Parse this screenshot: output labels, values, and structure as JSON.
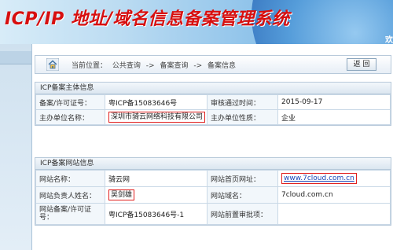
{
  "header": {
    "title": "ICP/IP 地址/域名信息备案管理系统",
    "side_text": "欢"
  },
  "breadcrumb": {
    "prefix": "当前位置：",
    "items": [
      "公共查询",
      "备案查询",
      "备案信息"
    ],
    "separator": "->",
    "back_label": "返 回"
  },
  "subject": {
    "heading": "ICP备案主体信息",
    "license_label": "备案/许可证号：",
    "license_value": "粤ICP备15083646号",
    "approve_time_label": "审核通过时间：",
    "approve_time_value": "2015-09-17",
    "org_name_label": "主办单位名称：",
    "org_name_value": "深圳市骑云网络科技有限公司",
    "org_type_label": "主办单位性质：",
    "org_type_value": "企业"
  },
  "website": {
    "heading": "ICP备案网站信息",
    "site_name_label": "网站名称：",
    "site_name_value": "骑云网",
    "homepage_label": "网站首页网址：",
    "homepage_value": "www.7cloud.com.cn",
    "owner_label": "网站负责人姓名：",
    "owner_value": "吴剑雄",
    "domain_label": "网站域名：",
    "domain_value": "7cloud.com.cn",
    "site_license_label": "网站备案/许可证号：",
    "site_license_value": "粤ICP备15083646号-1",
    "preapproval_label": "网站前置审批项：",
    "preapproval_value": ""
  }
}
